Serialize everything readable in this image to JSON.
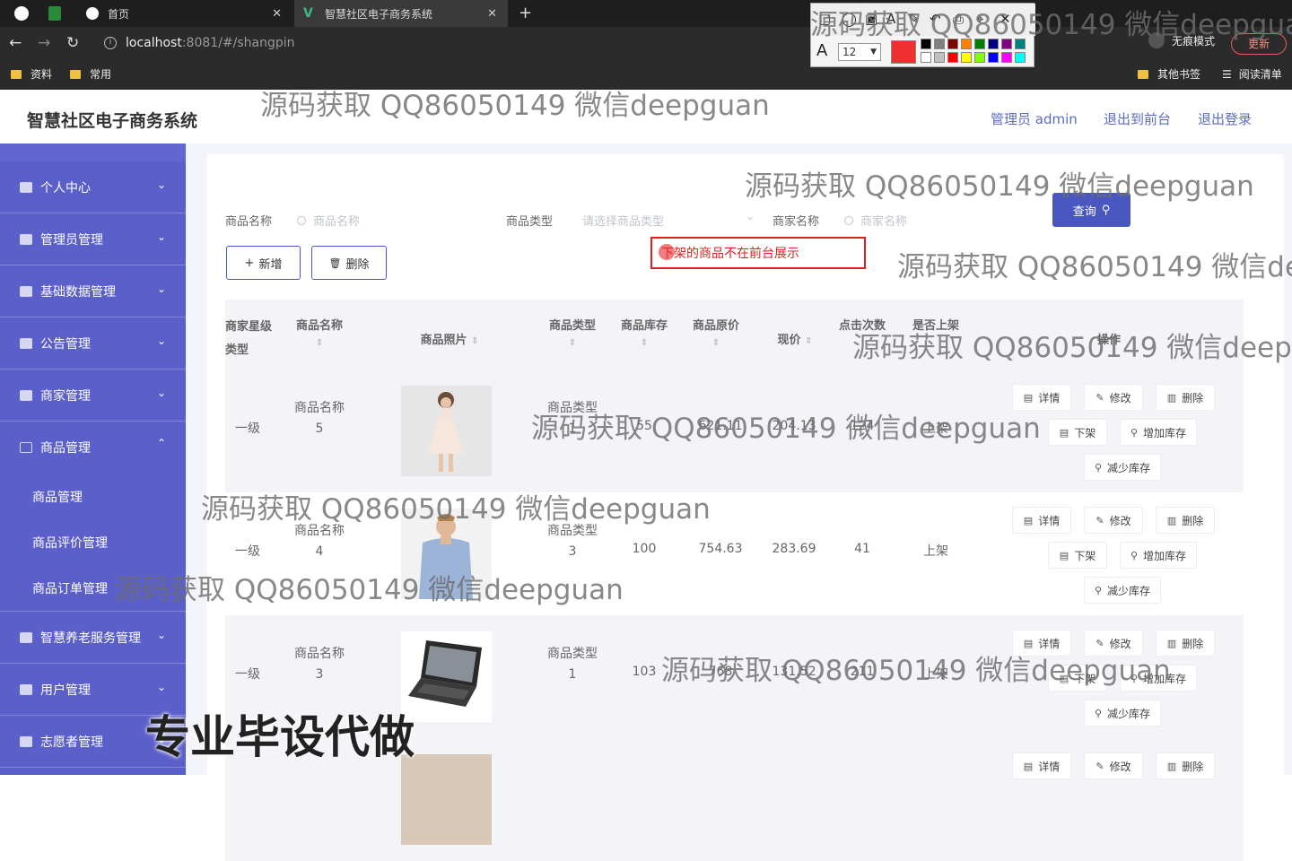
{
  "browser": {
    "tabs": [
      {
        "label": "首页"
      },
      {
        "label": "智慧社区电子商务系统"
      }
    ],
    "url_host": "localhost",
    "url_path": ":8081/#/shangpin",
    "incognito": "无痕模式",
    "update": "更新",
    "bookmarks": [
      "资料",
      "常用"
    ],
    "bookmarks_right": [
      "其他书签",
      "阅读清单"
    ]
  },
  "annotation_toolbar": {
    "font_size": "12",
    "current_color": "#f03030",
    "palette": [
      "#000000",
      "#808080",
      "#800000",
      "#ff8000",
      "#008000",
      "#000080",
      "#800080",
      "#008080",
      "#ffffff",
      "#c0c0c0",
      "#ff0000",
      "#ffff00",
      "#80ff00",
      "#0000ff",
      "#ff00ff",
      "#00ffff"
    ]
  },
  "header": {
    "title": "智慧社区电子商务系统",
    "admin": "管理员 admin",
    "to_front": "退出到前台",
    "logout": "退出登录"
  },
  "sidebar": {
    "items": [
      {
        "label": "个人中心"
      },
      {
        "label": "管理员管理"
      },
      {
        "label": "基础数据管理"
      },
      {
        "label": "公告管理"
      },
      {
        "label": "商家管理"
      },
      {
        "label": "商品管理",
        "expanded": true
      }
    ],
    "sub": [
      "商品管理",
      "商品评价管理",
      "商品订单管理"
    ],
    "items2": [
      {
        "label": "智慧养老服务管理"
      },
      {
        "label": "用户管理"
      },
      {
        "label": "志愿者管理"
      }
    ]
  },
  "filters": {
    "name_label": "商品名称",
    "name_placeholder": "商品名称",
    "type_label": "商品类型",
    "type_placeholder": "请选择商品类型",
    "shop_label": "商家名称",
    "shop_placeholder": "商家名称",
    "query": "查询"
  },
  "toolbar": {
    "add": "新增",
    "delete": "删除"
  },
  "annotation_note": "下架的商品不在前台展示",
  "table": {
    "headers": {
      "shop_level": "商家星级类型",
      "name": "商品名称",
      "photo": "商品照片",
      "type": "商品类型",
      "stock": "商品库存",
      "orig_price": "商品原价",
      "price": "现价",
      "clicks": "点击次数",
      "on_shelf": "是否上架",
      "actions": "操作"
    },
    "rows": [
      {
        "level": "一级",
        "name1": "商品名称",
        "name2": "5",
        "type1": "商品类型",
        "type2": "1",
        "stock": "55",
        "orig": "621.11",
        "price": "204.13",
        "clicks": "124",
        "shelf": "上架",
        "photo": "dress"
      },
      {
        "level": "一级",
        "name1": "商品名称",
        "name2": "4",
        "type1": "商品类型",
        "type2": "3",
        "stock": "100",
        "orig": "754.63",
        "price": "283.69",
        "clicks": "41",
        "shelf": "上架",
        "photo": "man-shirt"
      },
      {
        "level": "一级",
        "name1": "商品名称",
        "name2": "3",
        "type1": "商品类型",
        "type2": "1",
        "stock": "103",
        "orig": "768",
        "price": "131.52",
        "clicks": "211",
        "shelf": "上架",
        "photo": "laptop"
      }
    ],
    "actions": {
      "detail": "详情",
      "edit": "修改",
      "delete": "删除",
      "off_shelf": "下架",
      "add_stock": "增加库存",
      "reduce_stock": "减少库存"
    }
  },
  "watermark": {
    "text": "源码获取 QQ86050149 微信deepguan",
    "big": "专业毕设代做"
  }
}
